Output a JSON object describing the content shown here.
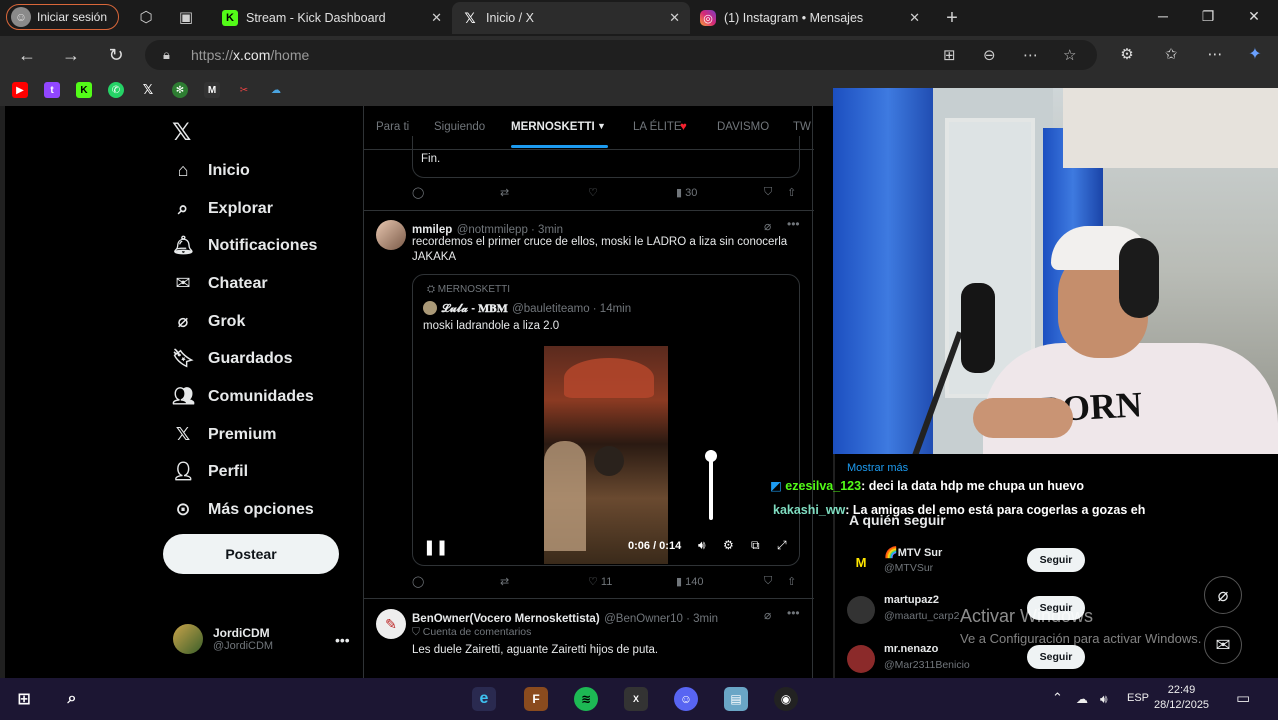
{
  "browser": {
    "login_label": "Iniciar sesión",
    "tabs": [
      {
        "title": "Stream - Kick Dashboard",
        "close": "✕"
      },
      {
        "title": "Inicio / X",
        "close": "✕"
      },
      {
        "title": "(1) Instagram • Mensajes",
        "close": "✕"
      }
    ],
    "new_tab": "+",
    "url_prefix": "https://",
    "url_host": "x.com",
    "url_path": "/home"
  },
  "x": {
    "logo": "𝕏",
    "nav": [
      {
        "label": "Inicio",
        "icon": "home-icon"
      },
      {
        "label": "Explorar",
        "icon": "search-icon"
      },
      {
        "label": "Notificaciones",
        "icon": "bell-icon"
      },
      {
        "label": "Chatear",
        "icon": "mail-icon"
      },
      {
        "label": "Grok",
        "icon": "grok-icon"
      },
      {
        "label": "Guardados",
        "icon": "bookmark-icon"
      },
      {
        "label": "Comunidades",
        "icon": "people-icon"
      },
      {
        "label": "Premium",
        "icon": "x-icon"
      },
      {
        "label": "Perfil",
        "icon": "person-icon"
      },
      {
        "label": "Más opciones",
        "icon": "more-circle-icon"
      }
    ],
    "post_button": "Postear",
    "profile": {
      "name": "JordiCDM",
      "handle": "@JordiCDM"
    },
    "tabs": [
      "Para ti",
      "Siguiendo",
      "MERNOSKETTI",
      "LA ÉLITE",
      "DAVISMO",
      "TW"
    ],
    "tweet0": {
      "text": "Fin.",
      "views": "30"
    },
    "tweet1": {
      "name": "mmilep",
      "handle": "@notmmilepp · 3min",
      "text": "recordemos el primer cruce de ellos, moski le LADRO a liza sin conocerla JAKAKA",
      "quote_context": "MERNOSKETTI",
      "quote_name": "𝓛𝓾𝓵𝓪 - 𝐌𝐁𝐌",
      "quote_handle": "@bauletiteamo · 14min",
      "quote_text": "moski ladrandole a liza 2.0",
      "video_time": "0:06 / 0:14",
      "likes": "11",
      "views": "140"
    },
    "tweet2": {
      "name": "BenOwner(Vocero Mernoskettista)",
      "handle": "@BenOwner10 · 3min",
      "badge": "Cuenta de comentarios",
      "text": "Les duele Zairetti, aguante Zairetti hijos de puta."
    },
    "right": {
      "show_more": "Mostrar más",
      "chat": [
        {
          "user": "ezesilva_123",
          "msg": ": deci la data hdp me chupa un huevo"
        },
        {
          "user": "kakashi_ww",
          "msg": ": La amigas del emo está para cogerlas a gozas eh"
        }
      ],
      "follow_title": "A quién seguir",
      "follow": [
        {
          "name": "🌈MTV Sur",
          "handle": "@MTVSur",
          "btn": "Seguir"
        },
        {
          "name": "martupaz2",
          "handle": "@maartu_carp2",
          "btn": "Seguir"
        },
        {
          "name": "mr.nenazo",
          "handle": "@Mar2311Benicio",
          "btn": "Seguir"
        }
      ],
      "watermark1": "Activar Windows",
      "watermark2": "Ve a Configuración para activar Windows."
    }
  },
  "taskbar": {
    "lang": "ESP",
    "time": "22:49",
    "date": "28/12/2025"
  },
  "colors": {
    "accent": "#1d9bf0",
    "kick": "#53fc18",
    "login_border": "#d9673a",
    "taskbar": "#1c1633"
  }
}
